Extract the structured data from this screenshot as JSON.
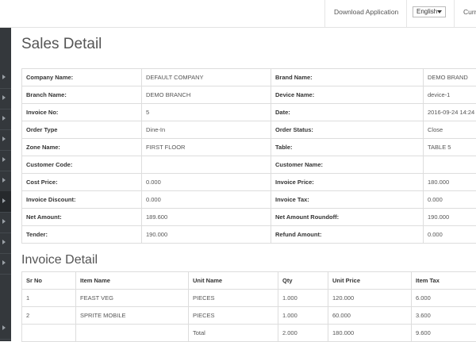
{
  "header": {
    "download_label": "Download Application",
    "language": "English",
    "currency_label": "Curr"
  },
  "page_title": "Sales Detail",
  "sales_info": [
    {
      "label1": "Company Name:",
      "value1": "DEFAULT COMPANY",
      "label2": "Brand Name:",
      "value2": "DEMO BRAND"
    },
    {
      "label1": "Branch Name:",
      "value1": "DEMO BRANCH",
      "label2": "Device Name:",
      "value2": "device-1"
    },
    {
      "label1": "Invoice No:",
      "value1": "5",
      "label2": "Date:",
      "value2": "2016-09-24 14:24"
    },
    {
      "label1": "Order Type",
      "value1": "Dine-In",
      "label2": "Order Status:",
      "value2": "Close"
    },
    {
      "label1": "Zone Name:",
      "value1": "FIRST FLOOR",
      "label2": "Table:",
      "value2": "TABLE 5"
    },
    {
      "label1": "Customer Code:",
      "value1": "",
      "label2": "Customer Name:",
      "value2": ""
    },
    {
      "label1": "Cost Price:",
      "value1": "0.000",
      "label2": "Invoice Price:",
      "value2": "180.000"
    },
    {
      "label1": "Invoice Discount:",
      "value1": "0.000",
      "label2": "Invoice Tax:",
      "value2": "0.000"
    },
    {
      "label1": "Net Amount:",
      "value1": "189.600",
      "label2": "Net Amount Roundoff:",
      "value2": "190.000"
    },
    {
      "label1": "Tender:",
      "value1": "190.000",
      "label2": "Refund Amount:",
      "value2": "0.000"
    }
  ],
  "invoice_detail": {
    "title": "Invoice Detail",
    "columns": [
      "Sr No",
      "Item Name",
      "Unit Name",
      "Qty",
      "Unit Price",
      "Item Tax"
    ],
    "rows": [
      [
        "1",
        "FEAST VEG",
        "PIECES",
        "1.000",
        "120.000",
        "6.000"
      ],
      [
        "2",
        "SPRITE MOBILE",
        "PIECES",
        "1.000",
        "60.000",
        "3.600"
      ]
    ],
    "total_row": [
      "",
      "",
      "Total",
      "2.000",
      "180.000",
      "9.600"
    ]
  }
}
